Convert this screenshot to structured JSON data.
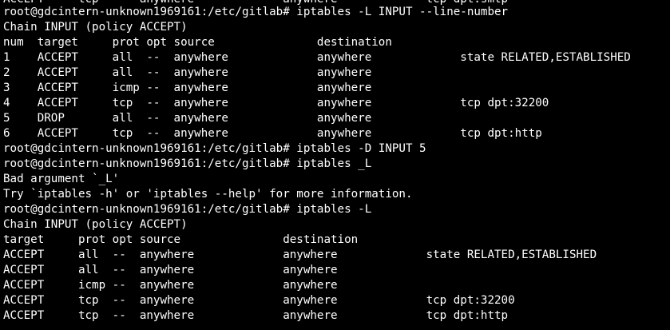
{
  "terminal": {
    "colors": {
      "background": "#000000",
      "text": "#ffffff"
    },
    "lines": [
      "ACCEPT     tcp  --  anywhere             anywhere             tcp dpt:smtp",
      "root@gdcintern-unknown1969161:/etc/gitlab# iptables -L INPUT --line-number",
      "Chain INPUT (policy ACCEPT)",
      "num  target     prot opt source               destination",
      "1    ACCEPT     all  --  anywhere             anywhere             state RELATED,ESTABLISHED",
      "2    ACCEPT     all  --  anywhere             anywhere",
      "3    ACCEPT     icmp --  anywhere             anywhere",
      "4    ACCEPT     tcp  --  anywhere             anywhere             tcp dpt:32200",
      "5    DROP       all  --  anywhere             anywhere",
      "6    ACCEPT     tcp  --  anywhere             anywhere             tcp dpt:http",
      "root@gdcintern-unknown1969161:/etc/gitlab# iptables -D INPUT 5",
      "root@gdcintern-unknown1969161:/etc/gitlab# iptables _L",
      "Bad argument `_L'",
      "Try `iptables -h' or 'iptables --help' for more information.",
      "root@gdcintern-unknown1969161:/etc/gitlab# iptables -L",
      "Chain INPUT (policy ACCEPT)",
      "target     prot opt source               destination",
      "ACCEPT     all  --  anywhere             anywhere             state RELATED,ESTABLISHED",
      "ACCEPT     all  --  anywhere             anywhere",
      "ACCEPT     icmp --  anywhere             anywhere",
      "ACCEPT     tcp  --  anywhere             anywhere             tcp dpt:32200",
      "ACCEPT     tcp  --  anywhere             anywhere             tcp dpt:http"
    ]
  }
}
